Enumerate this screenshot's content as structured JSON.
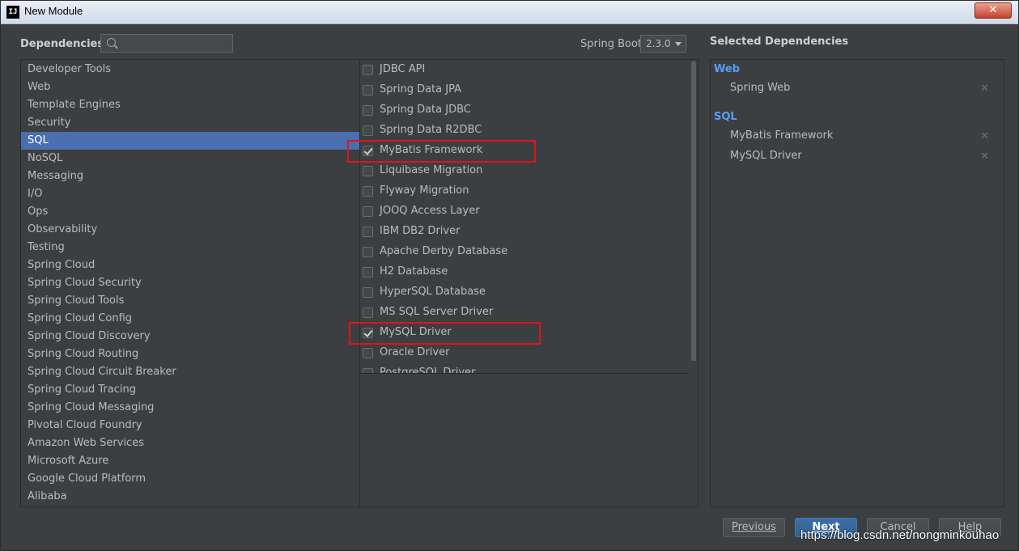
{
  "window": {
    "title": "New Module",
    "app_icon": "IJ",
    "close_glyph": "✕"
  },
  "header": {
    "dependencies_label": "Dependencies",
    "search_placeholder": "",
    "spring_boot_label": "Spring Boot",
    "spring_boot_version": "2.3.0",
    "selected_title": "Selected Dependencies"
  },
  "categories": [
    "Developer Tools",
    "Web",
    "Template Engines",
    "Security",
    "SQL",
    "NoSQL",
    "Messaging",
    "I/O",
    "Ops",
    "Observability",
    "Testing",
    "Spring Cloud",
    "Spring Cloud Security",
    "Spring Cloud Tools",
    "Spring Cloud Config",
    "Spring Cloud Discovery",
    "Spring Cloud Routing",
    "Spring Cloud Circuit Breaker",
    "Spring Cloud Tracing",
    "Spring Cloud Messaging",
    "Pivotal Cloud Foundry",
    "Amazon Web Services",
    "Microsoft Azure",
    "Google Cloud Platform",
    "Alibaba"
  ],
  "selected_category": "SQL",
  "dependencies": [
    {
      "label": "JDBC API",
      "checked": false
    },
    {
      "label": "Spring Data JPA",
      "checked": false
    },
    {
      "label": "Spring Data JDBC",
      "checked": false
    },
    {
      "label": "Spring Data R2DBC",
      "checked": false
    },
    {
      "label": "MyBatis Framework",
      "checked": true
    },
    {
      "label": "Liquibase Migration",
      "checked": false
    },
    {
      "label": "Flyway Migration",
      "checked": false
    },
    {
      "label": "JOOQ Access Layer",
      "checked": false
    },
    {
      "label": "IBM DB2 Driver",
      "checked": false
    },
    {
      "label": "Apache Derby Database",
      "checked": false
    },
    {
      "label": "H2 Database",
      "checked": false
    },
    {
      "label": "HyperSQL Database",
      "checked": false
    },
    {
      "label": "MS SQL Server Driver",
      "checked": false
    },
    {
      "label": "MySQL Driver",
      "checked": true
    },
    {
      "label": "Oracle Driver",
      "checked": false
    },
    {
      "label": "PostgreSQL Driver",
      "checked": false
    }
  ],
  "selected_dependencies": [
    {
      "group": "Web",
      "items": [
        "Spring Web"
      ]
    },
    {
      "group": "SQL",
      "items": [
        "MyBatis Framework",
        "MySQL Driver"
      ]
    }
  ],
  "buttons": {
    "previous": "Previous",
    "next": "Next",
    "cancel": "Cancel",
    "help": "Help"
  },
  "watermark": "https://blog.csdn.net/nongminkouhao",
  "colors": {
    "background": "#3c3f41",
    "selection": "#4b6eaf",
    "group_header": "#589df6",
    "highlight_box": "#e0141e"
  }
}
